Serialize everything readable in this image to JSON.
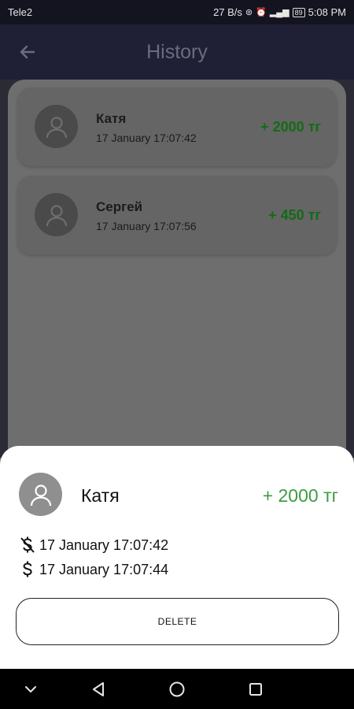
{
  "status_bar": {
    "carrier": "Tele2",
    "speed": "27 B/s",
    "battery": "89",
    "time": "5:08 PM"
  },
  "app_bar": {
    "title": "History"
  },
  "history": [
    {
      "name": "Катя",
      "date": "17 January 17:07:42",
      "amount": "+ 2000 тг"
    },
    {
      "name": "Сергей",
      "date": "17 January 17:07:56",
      "amount": "+ 450 тг"
    }
  ],
  "sheet": {
    "name": "Катя",
    "amount": "+ 2000 тг",
    "created": "17 January 17:07:42",
    "paid": "17 January 17:07:44",
    "delete_label": "DELETE"
  },
  "colors": {
    "amount_green": "#3c9c42",
    "app_bar": "#1f2036"
  },
  "icons": [
    "back-arrow-icon",
    "person-icon",
    "no-money-icon",
    "dollar-icon",
    "nav-back-icon",
    "nav-home-icon",
    "nav-recents-icon",
    "nav-down-icon"
  ]
}
